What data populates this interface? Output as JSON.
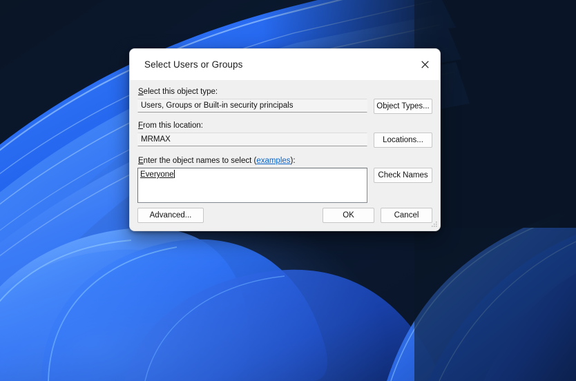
{
  "desktop": {
    "wallpaper_name": "windows-11-bloom-wallpaper",
    "colors": {
      "deep_navy": "#0a1526",
      "navy": "#102a52",
      "blue": "#1f56e0",
      "bright_blue": "#2d6bf5",
      "light_blue": "#4f96ff",
      "cyan_highlight": "#7fc4ff",
      "pale_streak": "#bcdcff"
    }
  },
  "dialog": {
    "title": "Select Users or Groups",
    "close_icon": "close-icon",
    "object_type": {
      "label": "Select this object type:",
      "accelerator": "S",
      "value": "Users, Groups or Built-in security principals",
      "button_label": "Object Types..."
    },
    "location": {
      "label": "From this location:",
      "accelerator": "F",
      "value": "MRMAX",
      "button_label": "Locations..."
    },
    "object_names": {
      "label_before": "Enter the object names to select (",
      "label_accelerator": "E",
      "label_rest": "nter the object names to select (",
      "link_text": "examples",
      "label_after": "):",
      "value": "Everyone",
      "placeholder": "",
      "button_label": "Check Names"
    },
    "buttons": {
      "advanced_label": "Advanced...",
      "ok_label": "OK",
      "cancel_label": "Cancel"
    },
    "resize_grip_icon": "resize-grip-icon"
  }
}
